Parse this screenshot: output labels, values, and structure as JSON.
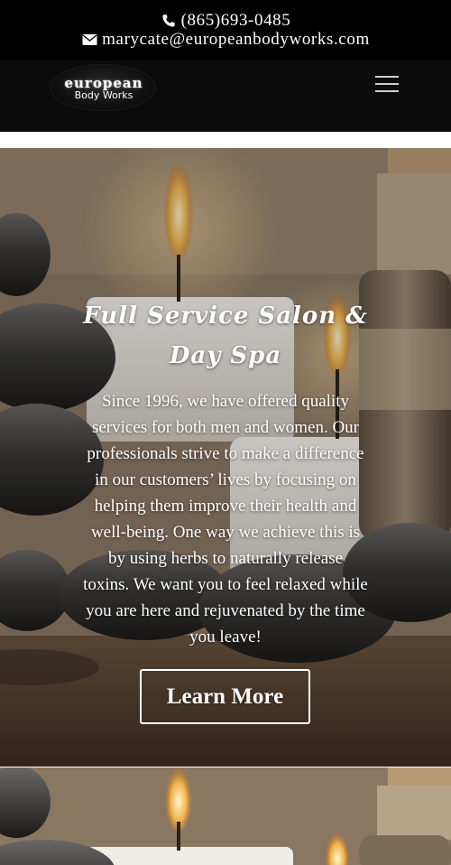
{
  "topbar": {
    "phone": "(865)693-0485",
    "email": "marycate@europeanbodyworks.com",
    "phone_icon": "phone-icon",
    "email_icon": "envelope-icon"
  },
  "header": {
    "logo_line1": "european",
    "logo_line2": "Body Works",
    "menu_icon": "hamburger-menu-icon"
  },
  "hero": {
    "title": "Full Service Salon & Day Spa",
    "body": "Since 1996, we have offered quality services for both men and women. Our professionals strive to make a difference in our customers’ lives by focusing on helping them improve their health and well-being. One way we achieve this is by using herbs to naturally release toxins. We want you to feel relaxed while you are here and rejuvenated by the time you leave!",
    "button_label": "Learn More"
  },
  "colors": {
    "topbar_bg": "#000000",
    "navbar_bg": "#0b0b0b",
    "text": "#ffffff"
  }
}
